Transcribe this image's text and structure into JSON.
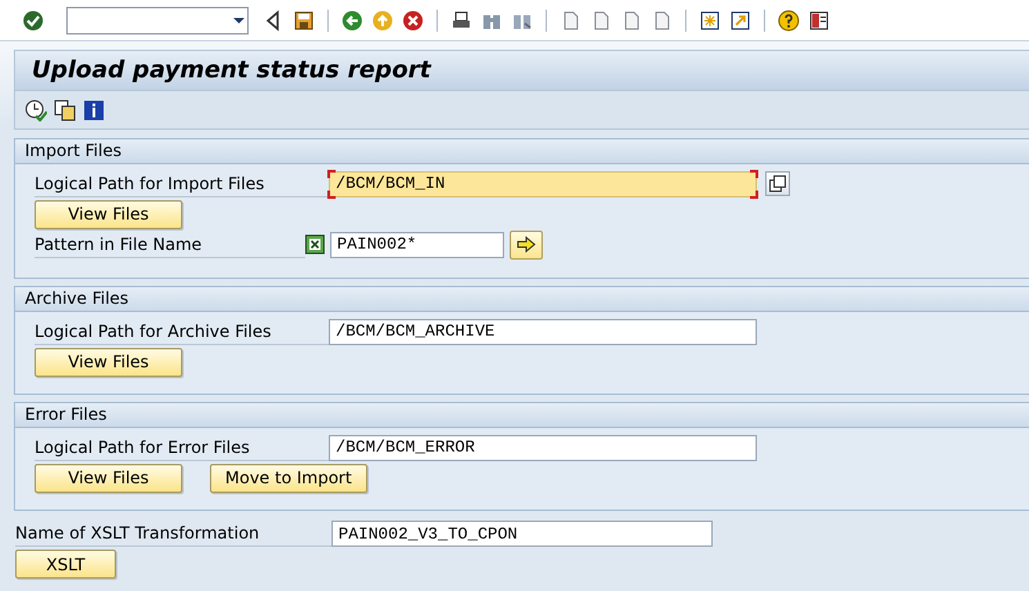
{
  "title": "Upload payment status report",
  "groups": [
    {
      "title": "Import Files",
      "rows": [
        {
          "kind": "field",
          "label": "Logical Path for Import Files",
          "value": "/BCM/BCM_IN",
          "focused": true
        },
        {
          "kind": "buttons",
          "buttons": [
            "View Files"
          ]
        },
        {
          "kind": "pattern",
          "label": "Pattern in File Name",
          "value": "PAIN002*",
          "focused": false
        }
      ]
    },
    {
      "title": "Archive Files",
      "rows": [
        {
          "kind": "field",
          "label": "Logical Path for Archive Files",
          "value": "/BCM/BCM_ARCHIVE",
          "focused": false
        },
        {
          "kind": "buttons",
          "buttons": [
            "View Files"
          ]
        }
      ]
    },
    {
      "title": "Error Files",
      "rows": [
        {
          "kind": "field",
          "label": "Logical Path for Error Files",
          "value": "/BCM/BCM_ERROR",
          "focused": false
        },
        {
          "kind": "buttons",
          "buttons": [
            "View Files",
            "Move to Import"
          ]
        }
      ]
    }
  ],
  "transformation": {
    "label": "Name of XSLT Transformation",
    "value": "PAIN002_V3_TO_CPON",
    "button": "XSLT"
  }
}
